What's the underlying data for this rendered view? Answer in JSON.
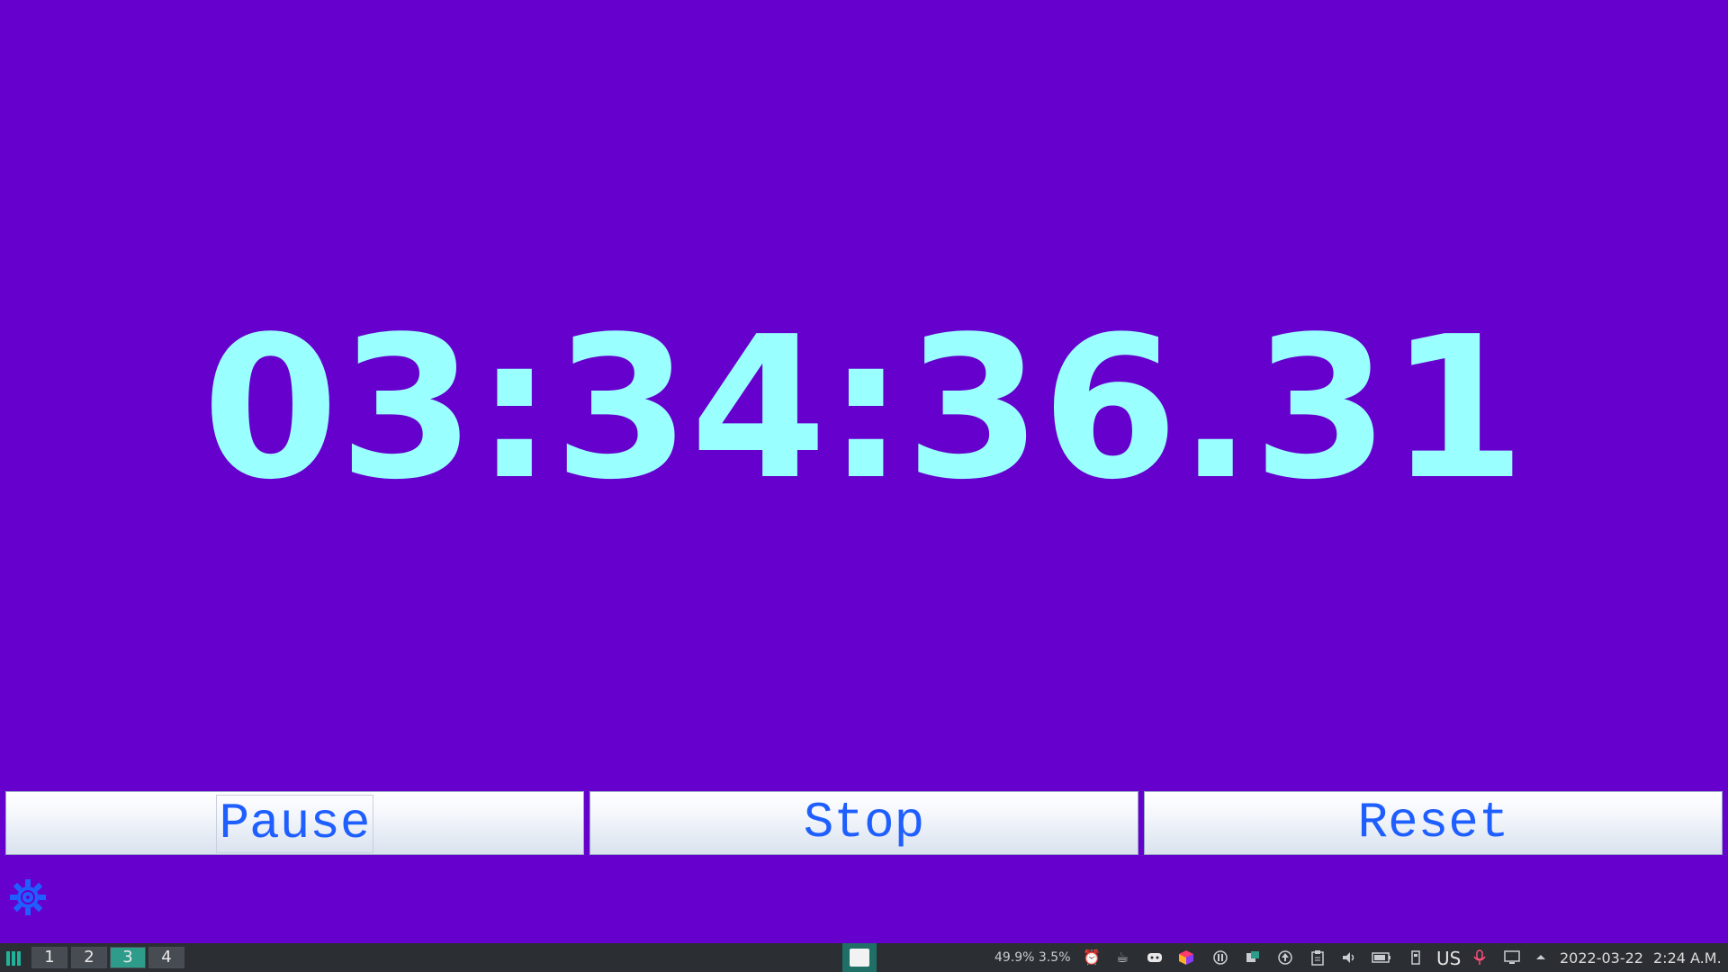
{
  "stopwatch": {
    "time": "03:34:36.31",
    "buttons": {
      "pause": "Pause",
      "stop": "Stop",
      "reset": "Reset"
    },
    "settings_icon": "gear-icon"
  },
  "taskbar": {
    "workspaces": [
      "1",
      "2",
      "3",
      "4"
    ],
    "active_workspace": "3",
    "cpu_usage": "49.9% 3.5%",
    "keyboard_layout": "US",
    "date": "2022-03-22",
    "time": "2:24 A.M.",
    "tray_icons": [
      "alarm-icon",
      "coffee-icon",
      "discord-icon",
      "colorful-cube-icon",
      "pause-icon",
      "window-icon",
      "upload-icon",
      "clipboard-icon",
      "volume-icon",
      "battery-icon",
      "usb-icon",
      "microphone-icon",
      "display-icon",
      "expand-tray-icon"
    ]
  },
  "colors": {
    "background": "#6600cc",
    "time_text": "#99ffff",
    "button_text": "#1f5fff",
    "taskbar": "#2b2e33",
    "active_workspace": "#2d9c8a"
  }
}
